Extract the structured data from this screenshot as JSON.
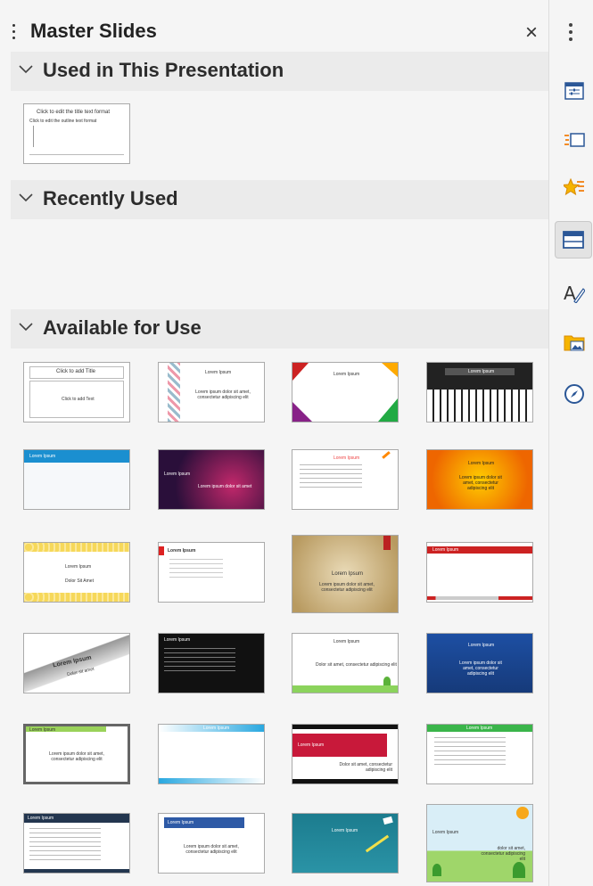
{
  "panel": {
    "title": "Master Slides",
    "close_label": "×"
  },
  "sections": {
    "used": {
      "title": "Used in This Presentation"
    },
    "recent": {
      "title": "Recently Used"
    },
    "available": {
      "title": "Available for Use"
    }
  },
  "used_thumb": {
    "title": "Click to edit the title text format",
    "outline": "Click to edit the outline text format"
  },
  "available_thumbs": [
    {
      "title": "Click to add Title",
      "body": "Click to add Text"
    },
    {
      "title": "Lorem Ipsum",
      "body": "Lorem ipsum dolor sit amet, consectetur adipiscing elit"
    },
    {
      "title": "Lorem Ipsum",
      "body": ""
    },
    {
      "title": "Lorem Ipsum",
      "body": ""
    },
    {
      "title": "Lorem Ipsum",
      "body": ""
    },
    {
      "title": "Lorem Ipsum",
      "body": "Lorem ipsum dolor sit amet"
    },
    {
      "title": "Lorem Ipsum",
      "body": ""
    },
    {
      "title": "Lorem Ipsum",
      "body": "Lorem ipsum dolor sit amet, consectetur adipiscing elit"
    },
    {
      "title": "Lorem Ipsum",
      "body": "Dolor Sit Amet"
    },
    {
      "title": "Lorem Ipsum",
      "body": ""
    },
    {
      "title": "Lorem Ipsum",
      "body": "Lorem ipsum dolor sit amet, consectetur adipiscing elit"
    },
    {
      "title": "Lorem Ipsum",
      "body": ""
    },
    {
      "title": "Lorem Ipsum",
      "body": "Dolor sit amet"
    },
    {
      "title": "Lorem Ipsum",
      "body": ""
    },
    {
      "title": "Lorem Ipsum",
      "body": "Dolor sit amet, consectetur adipiscing elit"
    },
    {
      "title": "Lorem Ipsum",
      "body": "Lorem ipsum dolor sit amet, consectetur adipiscing elit"
    },
    {
      "title": "Lorem Ipsum",
      "body": "Lorem ipsum dolor sit amet, consectetur adipiscing elit"
    },
    {
      "title": "Lorem Ipsum",
      "body": ""
    },
    {
      "title": "Lorem Ipsum",
      "body": "Dolor sit amet, consectetur adipiscing elit"
    },
    {
      "title": "Lorem Ipsum",
      "body": ""
    },
    {
      "title": "Lorem Ipsum",
      "body": ""
    },
    {
      "title": "Lorem Ipsum",
      "body": "Lorem ipsum dolor sit amet, consectetur adipiscing elit"
    },
    {
      "title": "Lorem Ipsum",
      "body": ""
    },
    {
      "title": "Lorem Ipsum",
      "body": "dolor sit amet, consectetur adipiscing elit"
    }
  ],
  "sidebar_icons": [
    "properties-icon",
    "slide-transition-icon",
    "animation-icon",
    "master-slides-icon",
    "styles-icon",
    "gallery-icon",
    "navigator-icon"
  ]
}
